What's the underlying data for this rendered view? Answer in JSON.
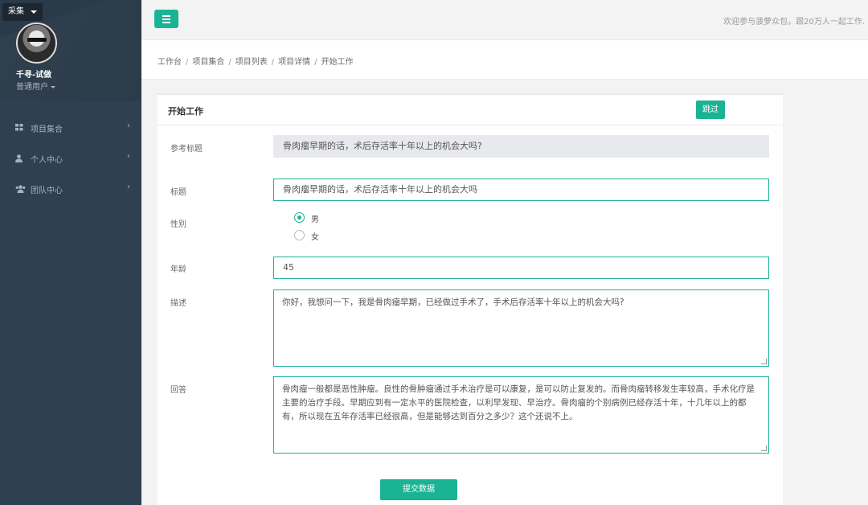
{
  "sidebar": {
    "collect_label": "采集",
    "user_name": "千寻-试做",
    "user_role": "普通用户",
    "items": [
      {
        "label": "项目集合",
        "icon": "grid-icon"
      },
      {
        "label": "个人中心",
        "icon": "user-icon"
      },
      {
        "label": "团队中心",
        "icon": "users-icon"
      }
    ]
  },
  "topbar": {
    "welcome": "欢迎参与菠萝众包，跟20万人一起工作."
  },
  "breadcrumb": [
    "工作台",
    "项目集合",
    "项目列表",
    "项目详情",
    "开始工作"
  ],
  "card": {
    "title": "开始工作",
    "skip_label": "跳过",
    "ref_title_label": "参考标题",
    "ref_title_value": "骨肉瘤早期的话，术后存活率十年以上的机会大吗?",
    "title_label": "标题",
    "title_value": "骨肉瘤早期的话，术后存活率十年以上的机会大吗",
    "gender_label": "性别",
    "gender_options": [
      "男",
      "女"
    ],
    "gender_selected": "男",
    "age_label": "年龄",
    "age_value": "45",
    "desc_label": "描述",
    "desc_value": "你好，我想问一下，我是骨肉瘤早期，已经做过手术了，手术后存活率十年以上的机会大吗?",
    "answer_label": "回答",
    "answer_value": "骨肉瘤一般都是恶性肿瘤。良性的骨肿瘤通过手术治疗是可以康复，是可以防止复发的。而骨肉瘤转移发生率较高，手术化疗是主要的治疗手段。早期应到有一定水平的医院检查，以利早发现、早治疗。骨肉瘤的个别病例已经存活十年，十几年以上的都有，所以现在五年存活率已经很高，但是能够达到百分之多少？这个还说不上。",
    "submit_label": "提交数据"
  },
  "colors": {
    "accent": "#1ab394",
    "sidebar_bg": "#2f4050"
  }
}
